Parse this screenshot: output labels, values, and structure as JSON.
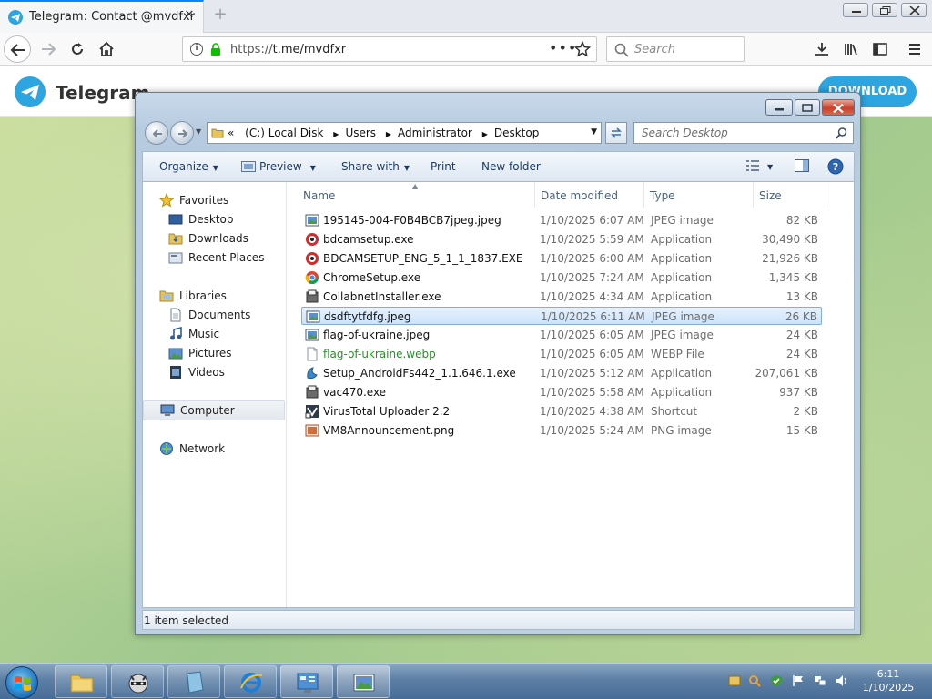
{
  "browser": {
    "tab_title": "Telegram: Contact @mvdfxr",
    "url_prefix": "https://",
    "url_domain": "t.me/mvdfxr",
    "search_placeholder": "Search"
  },
  "telegram": {
    "brand": "Telegram",
    "download_label": "DOWNLOAD",
    "accent": "#2ca5e0"
  },
  "explorer": {
    "breadcrumb_prefix": "«",
    "breadcrumb": [
      "(C:) Local Disk",
      "Users",
      "Administrator",
      "Desktop"
    ],
    "search_placeholder": "Search Desktop",
    "commands": {
      "organize": "Organize",
      "preview": "Preview",
      "share_with": "Share with",
      "print": "Print",
      "new_folder": "New folder"
    },
    "nav": {
      "favorites": "Favorites",
      "desktop": "Desktop",
      "downloads": "Downloads",
      "recent_places": "Recent Places",
      "libraries": "Libraries",
      "documents": "Documents",
      "music": "Music",
      "pictures": "Pictures",
      "videos": "Videos",
      "computer": "Computer",
      "network": "Network"
    },
    "columns": {
      "name": "Name",
      "date": "Date modified",
      "type": "Type",
      "size": "Size"
    },
    "files": [
      {
        "name": "195145-004-F0B4BCB7jpeg.jpeg",
        "date": "1/10/2025 6:07 AM",
        "type": "JPEG image",
        "size": "82 KB",
        "icon": "image-icon"
      },
      {
        "name": "bdcamsetup.exe",
        "date": "1/10/2025 5:59 AM",
        "type": "Application",
        "size": "30,490 KB",
        "icon": "bandicam-icon"
      },
      {
        "name": "BDCAMSETUP_ENG_5_1_1_1837.EXE",
        "date": "1/10/2025 6:00 AM",
        "type": "Application",
        "size": "21,926 KB",
        "icon": "bandicam-icon"
      },
      {
        "name": "ChromeSetup.exe",
        "date": "1/10/2025 7:24 AM",
        "type": "Application",
        "size": "1,345 KB",
        "icon": "chrome-icon"
      },
      {
        "name": "CollabnetInstaller.exe",
        "date": "1/10/2025 4:34 AM",
        "type": "Application",
        "size": "13 KB",
        "icon": "installer-icon"
      },
      {
        "name": "dsdftytfdfg.jpeg",
        "date": "1/10/2025 6:11 AM",
        "type": "JPEG image",
        "size": "26 KB",
        "icon": "image-icon"
      },
      {
        "name": "flag-of-ukraine.jpeg",
        "date": "1/10/2025 6:05 AM",
        "type": "JPEG image",
        "size": "24 KB",
        "icon": "image-icon"
      },
      {
        "name": "flag-of-ukraine.webp",
        "date": "1/10/2025 6:05 AM",
        "type": "WEBP File",
        "size": "24 KB",
        "icon": "file-icon"
      },
      {
        "name": "Setup_AndroidFs442_1.1.646.1.exe",
        "date": "1/10/2025 5:12 AM",
        "type": "Application",
        "size": "207,061 KB",
        "icon": "setup-icon"
      },
      {
        "name": "vac470.exe",
        "date": "1/10/2025 5:58 AM",
        "type": "Application",
        "size": "937 KB",
        "icon": "installer-icon"
      },
      {
        "name": "VirusTotal Uploader 2.2",
        "date": "1/10/2025 4:38 AM",
        "type": "Shortcut",
        "size": "2 KB",
        "icon": "shortcut-icon"
      },
      {
        "name": "VM8Announcement.png",
        "date": "1/10/2025 5:24 AM",
        "type": "PNG image",
        "size": "15 KB",
        "icon": "png-icon"
      }
    ],
    "selected_index": 5,
    "status": "1 item selected"
  },
  "taskbar": {
    "time": "6:11",
    "date": "1/10/2025"
  }
}
